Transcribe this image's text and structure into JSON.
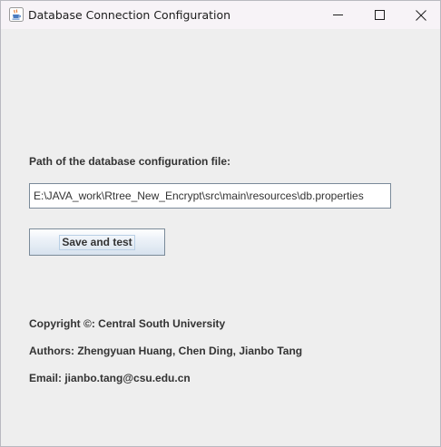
{
  "window": {
    "title": "Database Connection Configuration",
    "icon": "java-cup-icon",
    "controls": [
      "minimize-icon",
      "maximize-icon",
      "close-icon"
    ]
  },
  "form": {
    "path_label": "Path of the database configuration file:",
    "path_value": "E:\\JAVA_work\\Rtree_New_Encrypt\\src\\main\\resources\\db.properties",
    "save_button_label": "Save and test"
  },
  "info": {
    "copyright": "Copyright ©: Central South University",
    "authors": "Authors: Zhengyuan Huang, Chen Ding, Jianbo Tang",
    "email": "Email: jianbo.tang@csu.edu.cn"
  },
  "colors": {
    "background": "#eeeeee",
    "titlebar": "#f7f3f7",
    "text": "#333333",
    "border": "#7a8a99"
  }
}
